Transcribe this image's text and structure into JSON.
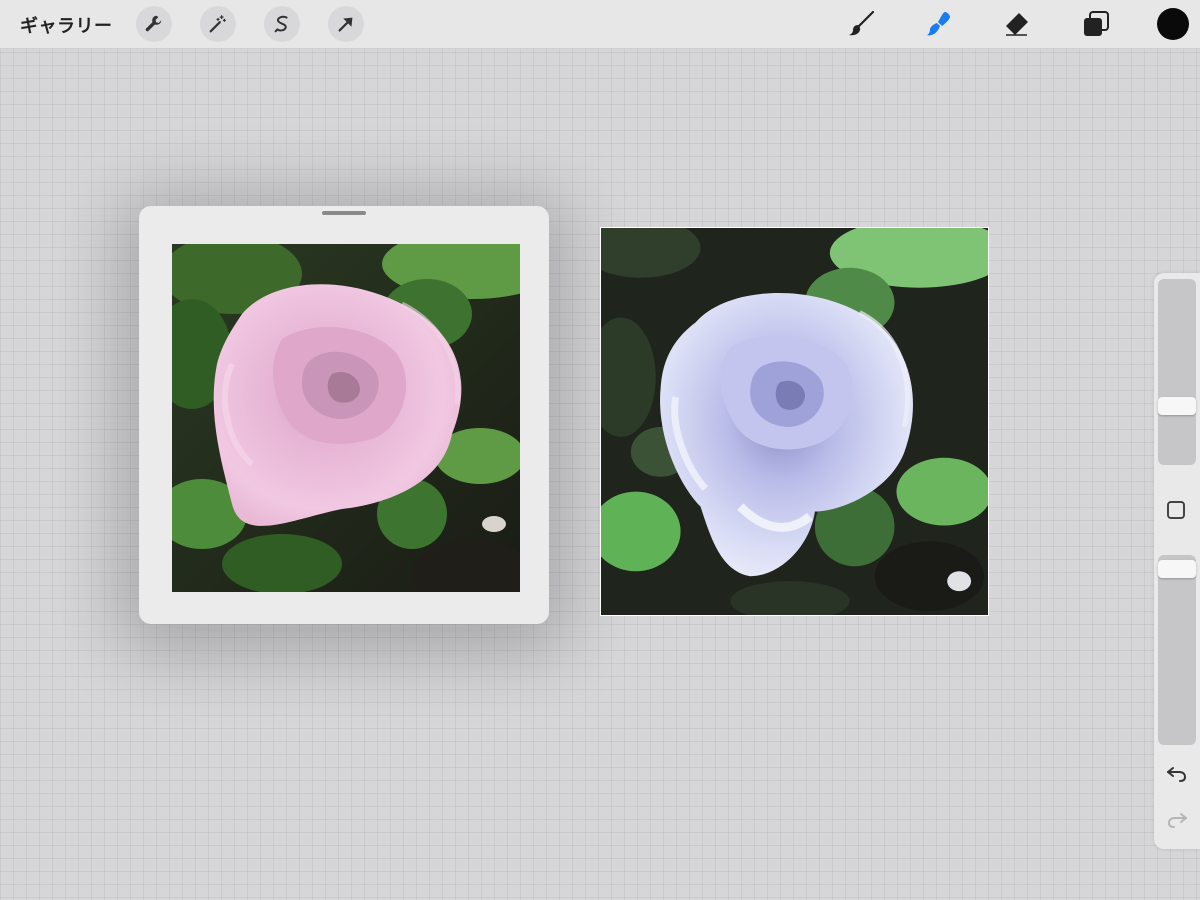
{
  "toolbar": {
    "gallery_label": "ギャラリー",
    "left_tools": [
      {
        "name": "wrench-icon",
        "label": "actions"
      },
      {
        "name": "magic-wand-icon",
        "label": "adjustments"
      },
      {
        "name": "selection-icon",
        "label": "selection"
      },
      {
        "name": "transform-arrow-icon",
        "label": "transform"
      }
    ],
    "right_tools": [
      {
        "name": "brush-icon",
        "active": false
      },
      {
        "name": "smudge-icon",
        "active": true
      },
      {
        "name": "eraser-icon",
        "active": false
      },
      {
        "name": "layers-icon",
        "active": false
      }
    ],
    "current_color": "#0a0a0a",
    "active_tool_color": "#1a7cf2"
  },
  "reference_window": {
    "subject": "pink-rose-photo"
  },
  "canvas": {
    "subject": "lavender-rose-painting"
  },
  "side_panel": {
    "brush_size_level": 0.3,
    "opacity_level": 0.03,
    "undo_icon": "undo-arrow-icon",
    "redo_icon": "redo-arrow-icon"
  }
}
